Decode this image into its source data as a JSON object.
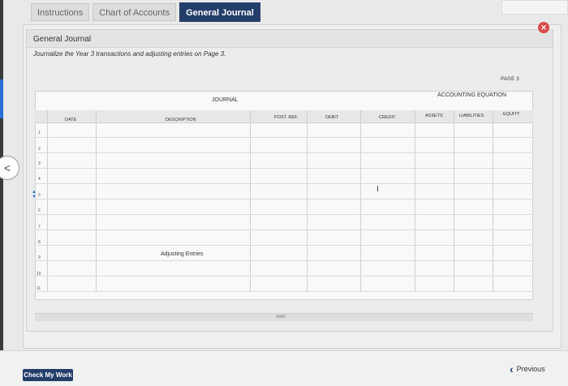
{
  "tabs": [
    {
      "label": "Instructions"
    },
    {
      "label": "Chart of Accounts"
    },
    {
      "label": "General Journal",
      "active": true
    }
  ],
  "panel": {
    "title": "General Journal",
    "instruction": "Journalize the Year 3 transactions and adjusting entries on Page 3."
  },
  "journal": {
    "page_label": "PAGE 3",
    "title": "JOURNAL",
    "accounting_equation": "ACCOUNTING EQUATION",
    "columns": [
      "DATE",
      "DESCRIPTION",
      "POST. REF.",
      "DEBIT",
      "CREDIT",
      "ASSETS",
      "LIABILITIES",
      "EQUITY"
    ],
    "rows": [
      "1",
      "2",
      "3",
      "4",
      "5",
      "6",
      "7",
      "8",
      "9",
      "10",
      "11"
    ],
    "adjusting_label": "Adjusting Entries"
  },
  "footer": {
    "check_label": "Check My Work",
    "previous_label": "Previous"
  },
  "colors": {
    "accent": "#243e6b",
    "close": "#d94b4b",
    "stepper": "#2a6fd6"
  }
}
